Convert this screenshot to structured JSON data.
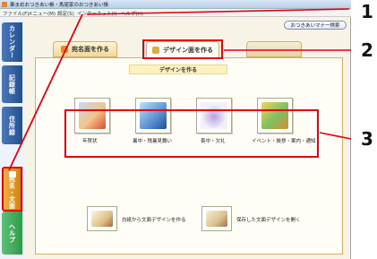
{
  "window": {
    "title": "筆まめおつきあい帳・馬尾家のおつきあい帳"
  },
  "menu": {
    "items": [
      "ファイル(F)",
      "メニュー(M)",
      "設定(S)",
      "インターネット(I)",
      "ヘルプ(H)"
    ]
  },
  "sidebar": {
    "tabs": [
      {
        "label": "カレンダー"
      },
      {
        "label": "記録帳"
      },
      {
        "label": "住所録"
      },
      {
        "label": "宛名・文面"
      },
      {
        "label": "ヘルプ"
      }
    ]
  },
  "toolbar": {
    "manner_label": "おつきあいマナー検索"
  },
  "tabs": {
    "address": "宛名面を作る",
    "design": "デザイン面を作る",
    "third": ""
  },
  "section": {
    "title": "デザインを作る"
  },
  "cards": [
    {
      "label": "年賀状"
    },
    {
      "label": "暑中・残暑見舞い"
    },
    {
      "label": "喪中・欠礼"
    },
    {
      "label": "イベント・挨拶・案内・通知"
    }
  ],
  "actions": [
    {
      "label": "白紙から文面デザインを作る"
    },
    {
      "label": "保存した文面デザインを開く"
    }
  ],
  "callouts": [
    "1",
    "2",
    "3"
  ],
  "colors": {
    "highlight": "#e60012",
    "sidebar_blue": "#2a5aa0",
    "active_orange": "#e89020",
    "help_green": "#3aa858"
  }
}
